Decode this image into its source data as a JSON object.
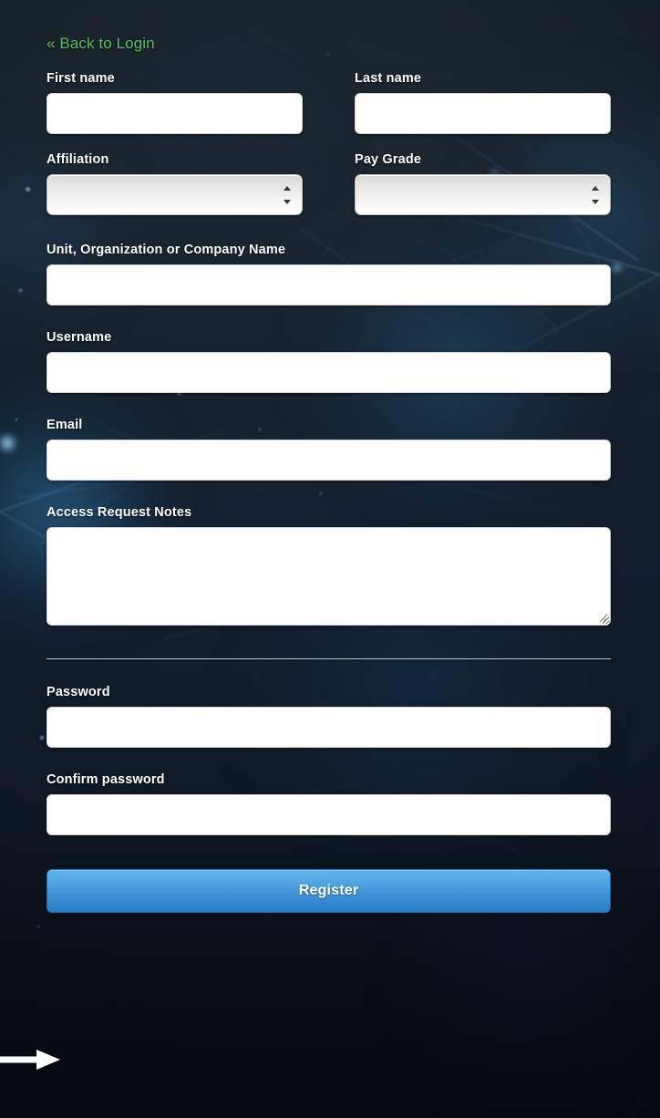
{
  "page": {
    "title": "Register",
    "background_description": "dark navy network constellation artwork",
    "colors": {
      "background_top": "#202c36",
      "background_bottom": "#0a1017",
      "link_green": "#5cb860",
      "label_white": "#ffffff",
      "button_blue_top": "#62b4e9",
      "button_blue_bottom": "#2a7cc7",
      "divider": "#c2c9cf",
      "annotation_arrow": "#ffffff"
    }
  },
  "back_link": {
    "label": "« Back to Login"
  },
  "form": {
    "fields": {
      "first_name": {
        "label": "First name",
        "value": "",
        "placeholder": ""
      },
      "last_name": {
        "label": "Last name",
        "value": "",
        "placeholder": ""
      },
      "affiliation": {
        "label": "Affiliation",
        "selected": "",
        "options": [
          ""
        ]
      },
      "pay_grade": {
        "label": "Pay Grade",
        "selected": "",
        "options": [
          ""
        ]
      },
      "unit_org": {
        "label": "Unit, Organization or Company Name",
        "value": "",
        "placeholder": ""
      },
      "username": {
        "label": "Username",
        "value": "",
        "placeholder": ""
      },
      "email": {
        "label": "Email",
        "value": "",
        "placeholder": ""
      },
      "access_request_notes": {
        "label": "Access Request Notes",
        "value": "",
        "placeholder": ""
      },
      "password": {
        "label": "Password",
        "value": "",
        "placeholder": ""
      },
      "confirm_password": {
        "label": "Confirm password",
        "value": "",
        "placeholder": ""
      }
    },
    "submit": {
      "label": "Register"
    }
  },
  "annotation": {
    "arrow_target": "Register"
  }
}
